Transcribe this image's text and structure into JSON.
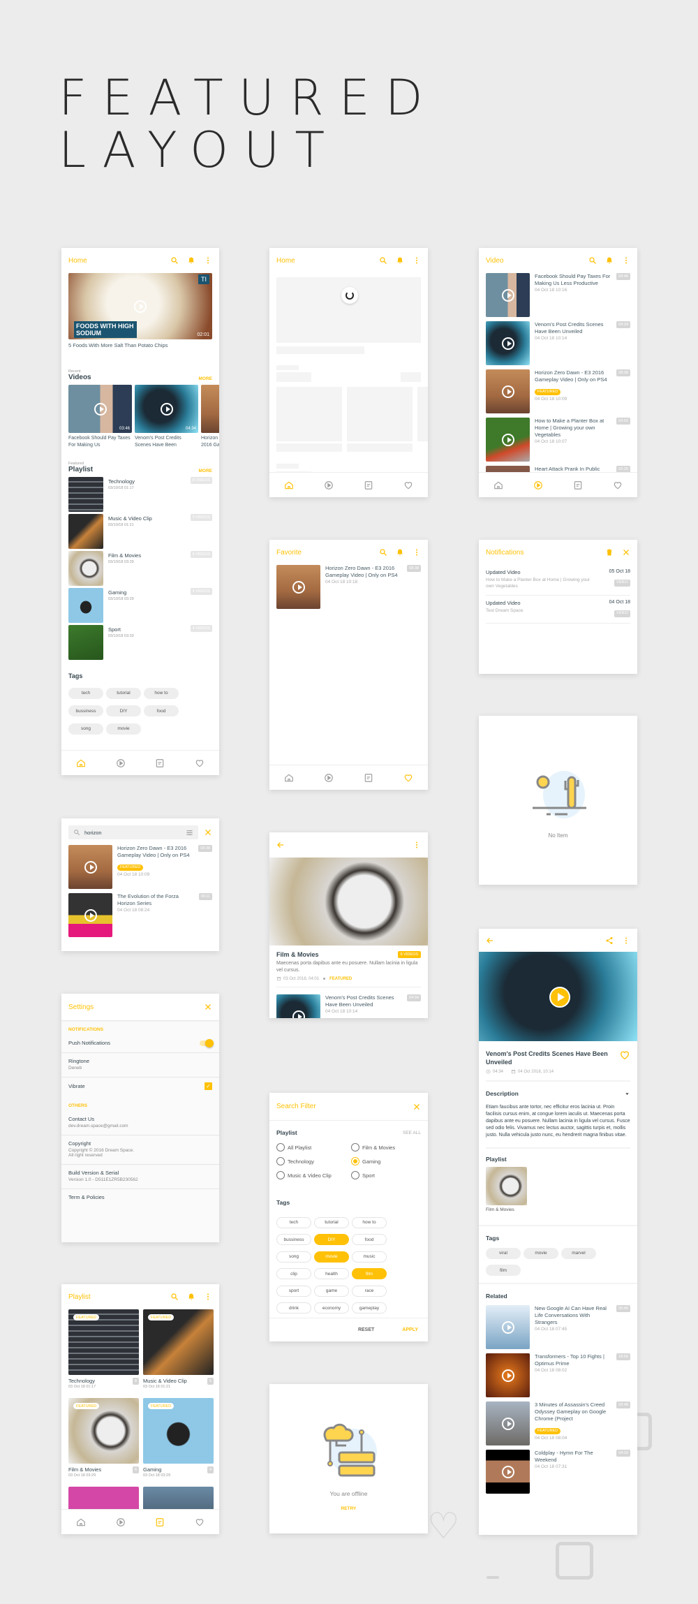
{
  "page": {
    "title_line1": "FEATURED",
    "title_line2": "LAYOUT"
  },
  "accent": "#FFC107",
  "home": {
    "title": "Home",
    "hero": {
      "overlay_text": "FOODS WITH HIGH SODIUM",
      "badge": "TI",
      "duration": "02:01",
      "caption": "5 Foods With More Salt Than Potato Chips",
      "thumb": "food"
    },
    "recent_label": "Recent",
    "videos_heading": "Videos",
    "more": "MORE",
    "videos": [
      {
        "title": "Facebook Should Pay Taxes For Making Us",
        "duration": "03:46",
        "thumb": "facebook"
      },
      {
        "title": "Venom's Post Credits Scenes Have Been",
        "duration": "04:34",
        "thumb": "venom"
      },
      {
        "title": "Horizon Zero Dawn - E3 2016 Ga",
        "duration": "",
        "thumb": "horizon"
      }
    ],
    "featured_label": "Featured",
    "playlist_heading": "Playlist",
    "playlists": [
      {
        "name": "Technology",
        "date": "03/10/18 01:17",
        "count": "8 VIDEOS",
        "thumb": "tech"
      },
      {
        "name": "Music & Video Clip",
        "date": "03/10/18 01:21",
        "count": "5 VIDEOS",
        "thumb": "music"
      },
      {
        "name": "Film & Movies",
        "date": "03/10/18 03:29",
        "count": "6 VIDEOS",
        "thumb": "film"
      },
      {
        "name": "Gaming",
        "date": "03/10/18 03:29",
        "count": "4 VIDEOS",
        "thumb": "gaming"
      },
      {
        "name": "Sport",
        "date": "03/10/18 03:33",
        "count": "4 VIDEOS",
        "thumb": "sport"
      }
    ],
    "tags_heading": "Tags",
    "tags": [
      "tech",
      "tutorial",
      "how to",
      "bussiness",
      "DIY",
      "food",
      "song",
      "movie"
    ]
  },
  "loading": {
    "title": "Home"
  },
  "video_list": {
    "title": "Video",
    "featured_label": "FEATURED",
    "items": [
      {
        "title": "Facebook Should Pay Taxes For Making Us Less Productive",
        "date": "04 Oct 18 10:16",
        "duration": "03:46",
        "thumb": "facebook",
        "featured": false
      },
      {
        "title": "Venom's Post Credits Scenes Have Been Unveiled",
        "date": "04 Oct 18 10:14",
        "duration": "04:34",
        "thumb": "venom",
        "featured": false
      },
      {
        "title": "Horizon Zero Dawn - E3 2016 Gameplay Video | Only on PS4",
        "date": "04 Oct 18 10:09",
        "duration": "08:38",
        "thumb": "horizon",
        "featured": true
      },
      {
        "title": "How to Make a Planter Box at Home | Growing your own Vegetables",
        "date": "04 Oct 18 10:07",
        "duration": "03:02",
        "thumb": "planter",
        "featured": false
      },
      {
        "title": "Heart Attack Prank In Public",
        "date": "",
        "duration": "02:25",
        "thumb": "prank",
        "featured": false
      }
    ]
  },
  "favorite": {
    "title": "Favorite",
    "items": [
      {
        "title": "Horizon Zero Dawn - E3 2016 Gameplay Video | Only on PS4",
        "date": "04 Oct 18 10:18",
        "duration": "08:38",
        "thumb": "horizon",
        "featured": false
      }
    ]
  },
  "notifications": {
    "title": "Notifications",
    "items": [
      {
        "title": "Updated Video",
        "desc": "How to Make a Planter Box at Home | Growing your own Vegetables",
        "date": "05 Oct 18",
        "badge": "VIDEO"
      },
      {
        "title": "Updated Video",
        "desc": "Test Dream Space",
        "date": "04 Oct 18",
        "badge": "VIDEO"
      }
    ]
  },
  "empty": {
    "text": "No Item"
  },
  "search": {
    "query": "horizon",
    "featured_label": "FEATURED",
    "results": [
      {
        "title": "Horizon Zero Dawn - E3 2016 Gameplay Video | Only on PS4",
        "date": "04 Oct 18 10:09",
        "duration": "08:38",
        "thumb": "horizon",
        "featured": true
      },
      {
        "title": "The Evolution of the Forza Horizon Series",
        "date": "04 Oct 18 08:24",
        "duration": "06:11",
        "thumb": "forza",
        "featured": false
      }
    ]
  },
  "playlist_detail": {
    "name": "Film & Movies",
    "count": "6 VIDEOS",
    "description": "Maecenas porta dapibus ante eu posuere. Nullam lacinia in ligula vel cursus.",
    "date": "03 Oct 2018, 04:01",
    "featured": "FEATURED",
    "items": [
      {
        "title": "Venom's Post Credits Scenes Have Been Unveiled",
        "date": "04 Oct 18 10:14",
        "duration": "04:34",
        "thumb": "venom",
        "featured": false
      }
    ]
  },
  "settings": {
    "title": "Settings",
    "notifications_label": "NOTIFICATIONS",
    "push": "Push Notifications",
    "push_on": true,
    "ringtone": "Ringtone",
    "ringtone_value": "Deneb",
    "vibrate": "Vibrate",
    "vibrate_on": true,
    "others_label": "OTHERS",
    "contact": "Contact Us",
    "contact_value": "dev.dream.space@gmail.com",
    "copyright": "Copyright",
    "copyright_value": "Copyright © 2016 Dream Space.",
    "copyright_value2": "All right reserved",
    "build": "Build Version & Serial",
    "build_value": "Version 1.0  -  D511E1ZR5B230562",
    "terms": "Term & Policies"
  },
  "filter": {
    "title": "Search Filter",
    "playlist_heading": "Playlist",
    "see_all": "SEE ALL",
    "options": [
      {
        "label": "All Playlist",
        "checked": false
      },
      {
        "label": "Film & Movies",
        "checked": false
      },
      {
        "label": "Technology",
        "checked": false
      },
      {
        "label": "Gaming",
        "checked": true
      },
      {
        "label": "Music & Video Clip",
        "checked": false
      },
      {
        "label": "Sport",
        "checked": false
      }
    ],
    "tags_heading": "Tags",
    "tags": [
      {
        "label": "tech",
        "selected": false
      },
      {
        "label": "tutorial",
        "selected": false
      },
      {
        "label": "how to",
        "selected": false
      },
      {
        "label": "bussiness",
        "selected": false
      },
      {
        "label": "DIY",
        "selected": true
      },
      {
        "label": "food",
        "selected": false
      },
      {
        "label": "song",
        "selected": false
      },
      {
        "label": "movie",
        "selected": true
      },
      {
        "label": "music",
        "selected": false
      },
      {
        "label": "clip",
        "selected": false
      },
      {
        "label": "health",
        "selected": false
      },
      {
        "label": "film",
        "selected": true
      },
      {
        "label": "sport",
        "selected": false
      },
      {
        "label": "game",
        "selected": false
      },
      {
        "label": "race",
        "selected": false
      },
      {
        "label": "drink",
        "selected": false
      },
      {
        "label": "economy",
        "selected": false
      },
      {
        "label": "gameplay",
        "selected": false
      }
    ],
    "reset": "RESET",
    "apply": "APPLY"
  },
  "video_detail": {
    "title": "Venom's Post Credits Scenes Have Been Unveiled",
    "duration": "04:34",
    "date": "04 Oct 2018, 10:14",
    "description_heading": "Description",
    "description": "Etiam faucibus ante tortor, nec efficitur eros lacinia ut. Proin facilisis cursus enim, at congue lorem iaculis ut. Maecenas porta dapibus ante eu posuere. Nullam lacinia in ligula vel cursus. Fusce sed odio felis. Vivamus nec lectus auctor, sagittis turpis et, mollis justo. Nulla vehicula justo nunc, eu hendrerit magna finibus vitae.",
    "playlist_heading": "Playlist",
    "playlist_name": "Film & Movies",
    "tags_heading": "Tags",
    "tags": [
      "viral",
      "movie",
      "marvel",
      "film"
    ],
    "related_heading": "Related",
    "featured_label": "FEATURED",
    "related": [
      {
        "title": "New Google AI Can Have Real Life Conversations With Strangers",
        "date": "04 Oct 18 07:45",
        "duration": "05:45",
        "thumb": "google",
        "featured": false
      },
      {
        "title": "Transformers - Top 10 Fights | Optimus Prime",
        "date": "04 Oct 18 08:02",
        "duration": "18:56",
        "thumb": "transformers",
        "featured": false
      },
      {
        "title": "3 Minutes of Assassin's Creed Odyssey Gameplay on Google Chrome (Project",
        "date": "04 Oct 18 08:04",
        "duration": "03:48",
        "thumb": "assassin",
        "featured": true
      },
      {
        "title": "Coldplay - Hymn For The Weekend",
        "date": "04 Oct 18 07:31",
        "duration": "04:20",
        "thumb": "coldplay",
        "featured": false
      }
    ]
  },
  "playlist_grid": {
    "title": "Playlist",
    "featured_label": "FEATURED",
    "items": [
      {
        "name": "Technology",
        "date": "03 Oct 18 01:17",
        "count": "8",
        "thumb": "tech"
      },
      {
        "name": "Music & Video Clip",
        "date": "03 Oct 18 01:21",
        "count": "5",
        "thumb": "music"
      },
      {
        "name": "Film & Movies",
        "date": "03 Oct 18 03:29",
        "count": "6",
        "thumb": "film"
      },
      {
        "name": "Gaming",
        "date": "03 Oct 18 03:29",
        "count": "4",
        "thumb": "gaming"
      },
      {
        "name": "",
        "date": "",
        "count": "",
        "thumb": "flower"
      },
      {
        "name": "",
        "date": "",
        "count": "",
        "thumb": "micro"
      }
    ]
  },
  "offline": {
    "text": "You are offline",
    "retry": "RETRY"
  }
}
